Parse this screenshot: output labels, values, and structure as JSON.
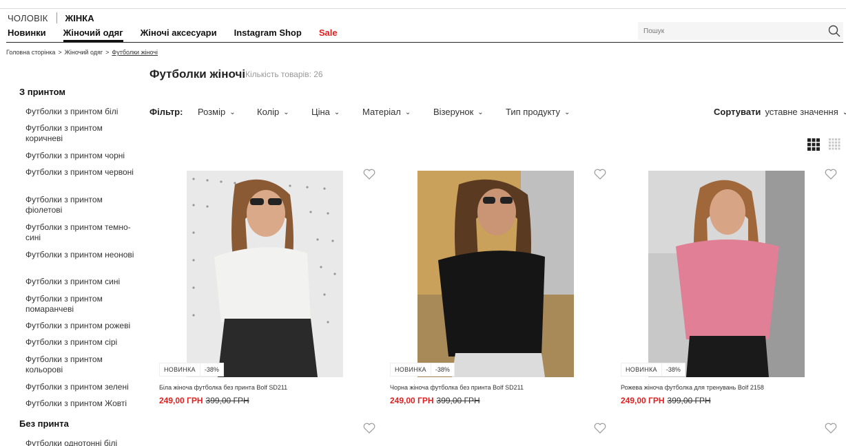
{
  "header": {
    "gender_men": "ЧОЛОВІК",
    "gender_women": "ЖІНКА",
    "nav": [
      {
        "label": "Новинки"
      },
      {
        "label": "Жіночий одяг"
      },
      {
        "label": "Жіночі аксесуари"
      },
      {
        "label": "Instagram Shop"
      },
      {
        "label": "Sale"
      }
    ],
    "search_placeholder": "Пошук"
  },
  "breadcrumb": {
    "items": [
      "Головна сторінка",
      "Жіночий одяг",
      "Футболки жіночі"
    ],
    "separator": ">"
  },
  "page": {
    "title": "Футболки жіночі",
    "count": "Кількість товарів: 26"
  },
  "filters": {
    "label": "Фільтр:",
    "items": [
      "Розмір",
      "Колір",
      "Ціна",
      "Матеріал",
      "Візерунок",
      "Тип продукту"
    ]
  },
  "sort": {
    "label": "Сортувати",
    "value": "уставне значення"
  },
  "sidebar": {
    "group1": "З принтом",
    "group1_items": [
      "Футболки з принтом білі",
      "Футболки з принтом коричневі",
      "Футболки з принтом чорні",
      "Футболки з принтом червоні",
      "Футболки з принтом фіолетові",
      "Футболки з принтом темно-сині",
      "Футболки з принтом неонові",
      "Футболки з принтом сині",
      "Футболки з принтом помаранчеві",
      "Футболки з принтом рожеві",
      "Футболки з принтом сірі",
      "Футболки з принтом кольорові",
      "Футболки з принтом зелені",
      "Футболки з принтом Жовті"
    ],
    "group2": "Без принта",
    "group2_items": [
      "Футболки однотонні білі"
    ]
  },
  "products": [
    {
      "name": "Біла жіноча футболка без принта Bolf SD211",
      "badge_new": "НОВИНКА",
      "badge_discount": "-38%",
      "price": "249,00 ГРН",
      "old_price": "399,00 ГРН",
      "shirt_color": "#f2f2f0",
      "bg_color": "#e9e9e9"
    },
    {
      "name": "Чорна жіноча футболка без принта Bolf SD211",
      "badge_new": "НОВИНКА",
      "badge_discount": "-38%",
      "price": "249,00 ГРН",
      "old_price": "399,00 ГРН",
      "shirt_color": "#151515",
      "bg_color": "#c9a15a"
    },
    {
      "name": "Рожева жіноча футболка для тренувань Bolf 2158",
      "badge_new": "НОВИНКА",
      "badge_discount": "-38%",
      "price": "249,00 ГРН",
      "old_price": "399,00 ГРН",
      "shirt_color": "#e07f95",
      "bg_color": "#c8c8c8"
    }
  ],
  "colors": {
    "accent_sale": "#e02020",
    "price": "#e02020"
  }
}
